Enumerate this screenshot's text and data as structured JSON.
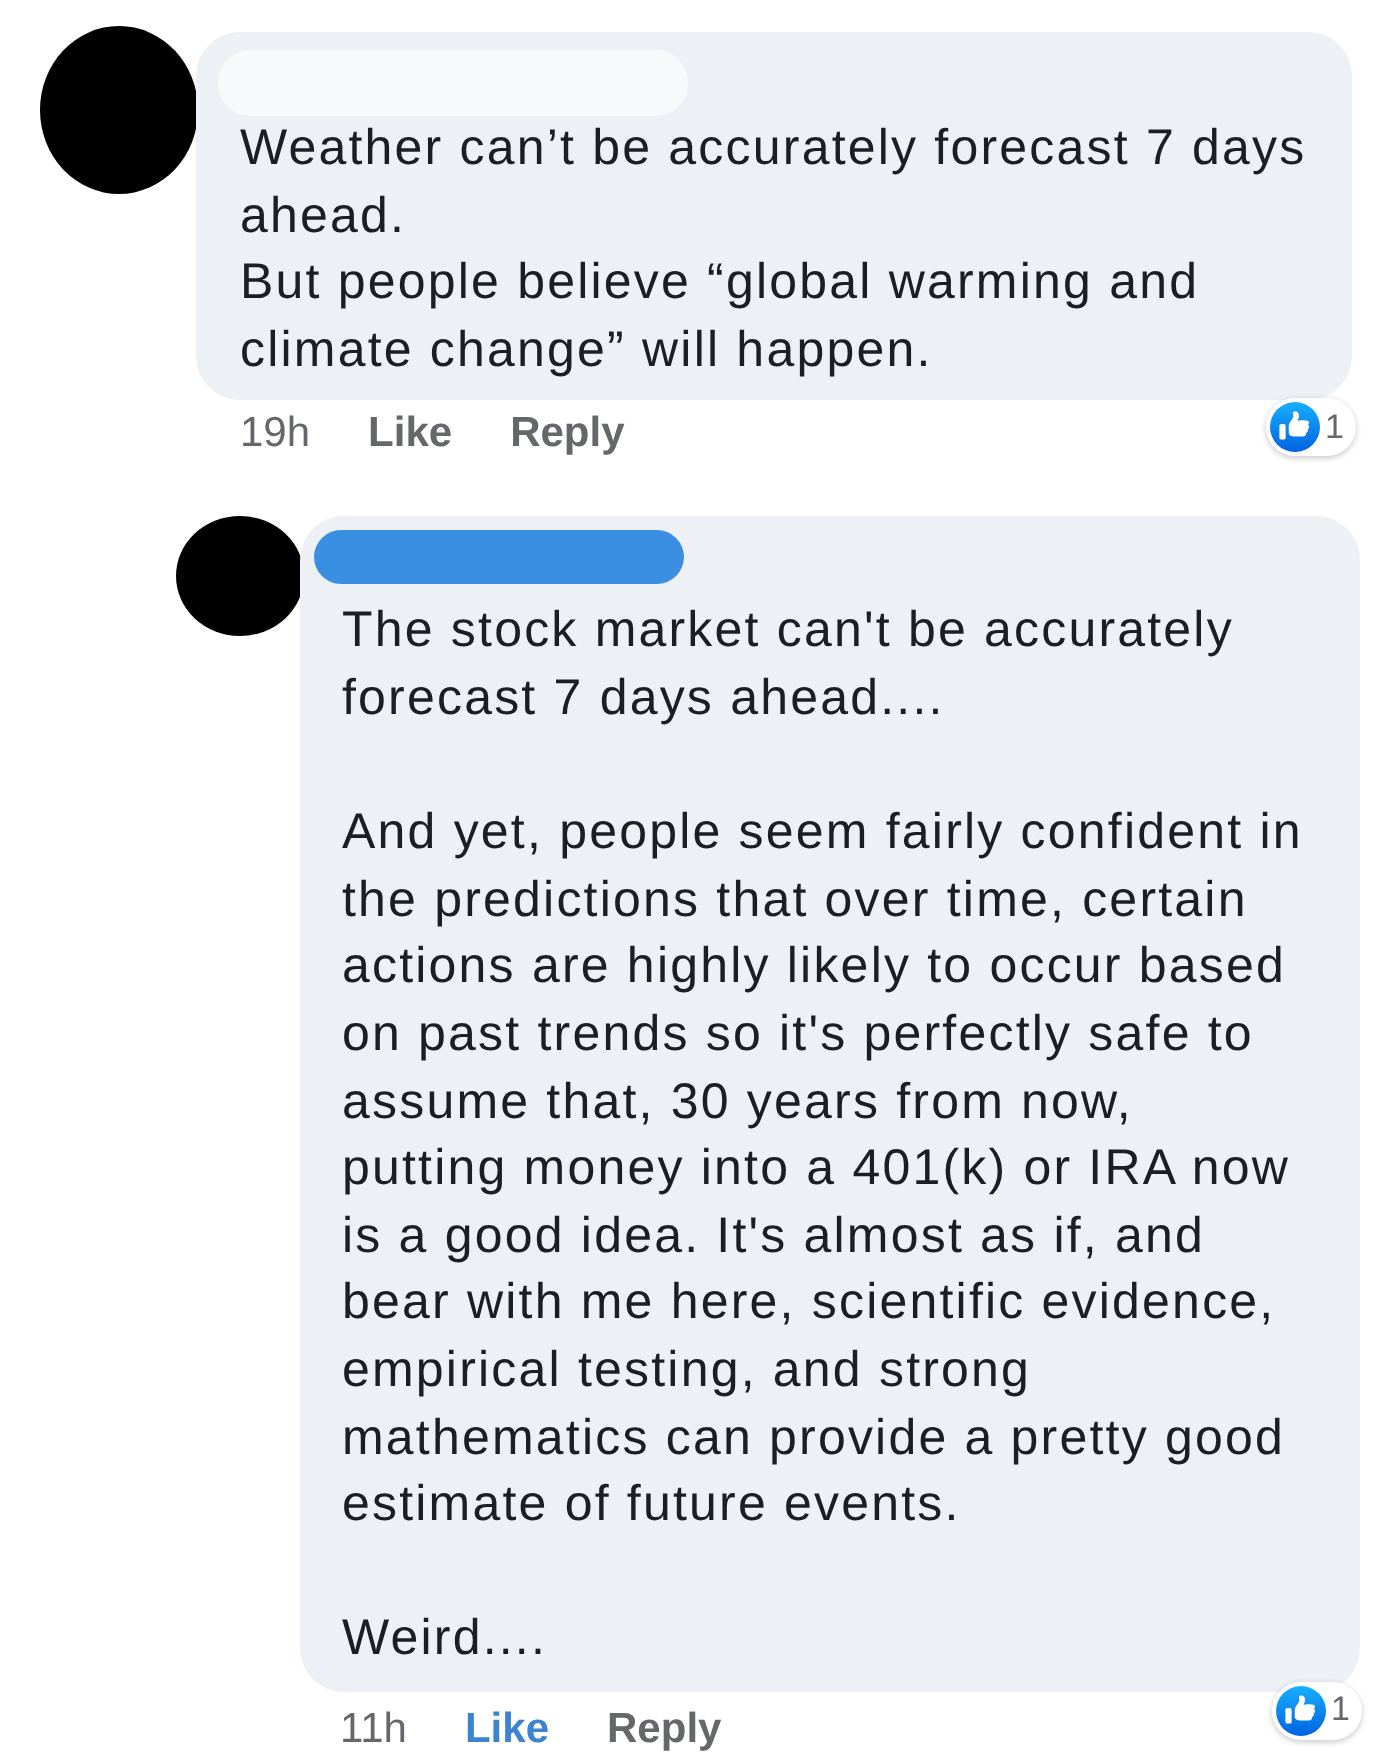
{
  "comments": [
    {
      "name_mark": {
        "color": "#f8f9fb"
      },
      "text": "Weather can’t be accurately forecast 7 days ahead.\nBut people believe “global warming and climate change” will happen.",
      "time": "19h",
      "like_label": "Like",
      "liked": false,
      "reply_label": "Reply",
      "reaction_count": "1",
      "replies": [
        {
          "name_mark": {
            "color": "#3b8fe3"
          },
          "text": "The stock market can't be accurately forecast 7 days ahead....\n\nAnd yet, people seem fairly confident in the predictions that over time, certain actions are highly likely to occur based on past trends so it's perfectly safe to assume that, 30 years from now, putting money into a 401(k) or IRA now is a good idea. It's almost as if, and bear with me here, scientific evidence, empirical testing, and strong mathematics can provide a pretty good estimate of future events.\n\nWeird....",
          "time": "11h",
          "like_label": "Like",
          "liked": true,
          "reply_label": "Reply",
          "reaction_count": "1"
        }
      ]
    }
  ]
}
